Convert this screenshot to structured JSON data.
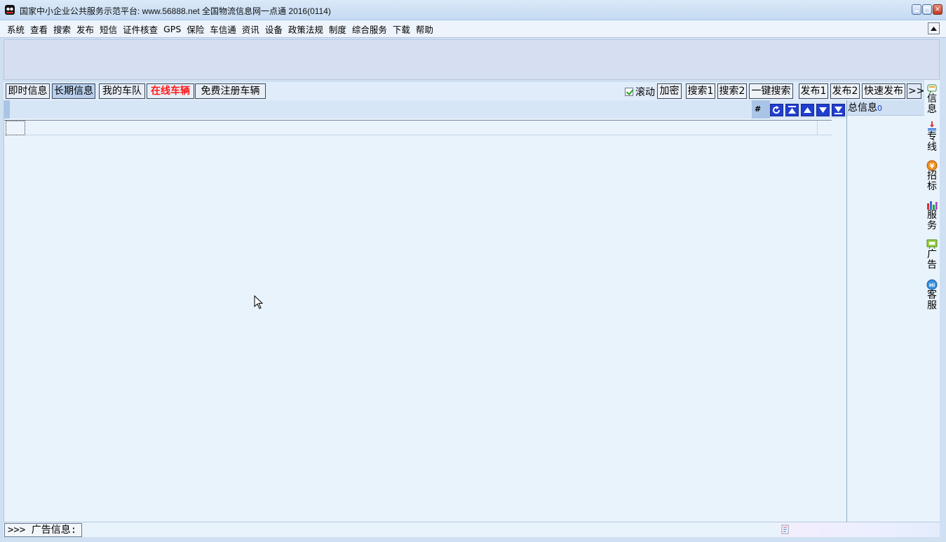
{
  "window": {
    "title": "国家中小企业公共服务示范平台: www.56888.net 全国物流信息网一点通 2016(0114)"
  },
  "menu": [
    "系统",
    "查看",
    "搜索",
    "发布",
    "短信",
    "证件核查",
    "GPS",
    "保险",
    "车信通",
    "资讯",
    "设备",
    "政策法规",
    "制度",
    "综合服务",
    "下载",
    "帮助"
  ],
  "tabs": {
    "instant": "即时信息",
    "longterm": "长期信息",
    "fleet": "我的车队",
    "online": "在线车辆",
    "register": "免费注册车辆"
  },
  "tools": {
    "scroll": "滚动",
    "scroll_checked": true,
    "encrypt": "加密",
    "search1": "搜索1",
    "search2": "搜索2",
    "one_click_search": "一键搜索",
    "publish1": "发布1",
    "publish2": "发布2",
    "quick_publish": "快速发布",
    "more": ">>"
  },
  "grid": {
    "hash": "#",
    "selected_tab": "长期信息"
  },
  "info_panel": {
    "label": "总信息",
    "count": "0"
  },
  "sidebar": [
    {
      "label": "信息",
      "icon": "message-icon"
    },
    {
      "label": "专线",
      "icon": "route-icon"
    },
    {
      "label": "招标",
      "icon": "tender-icon"
    },
    {
      "label": "服务",
      "icon": "service-chart-icon"
    },
    {
      "label": "广告",
      "icon": "ad-icon"
    },
    {
      "label": "客服",
      "icon": "hi-chat-icon"
    }
  ],
  "status": {
    "ad_label": ">>> 广告信息:"
  },
  "colors": {
    "online_red": "#ff1a1a",
    "nav_blue": "#1f3fd0",
    "panel_bg": "#e9f3fc"
  }
}
